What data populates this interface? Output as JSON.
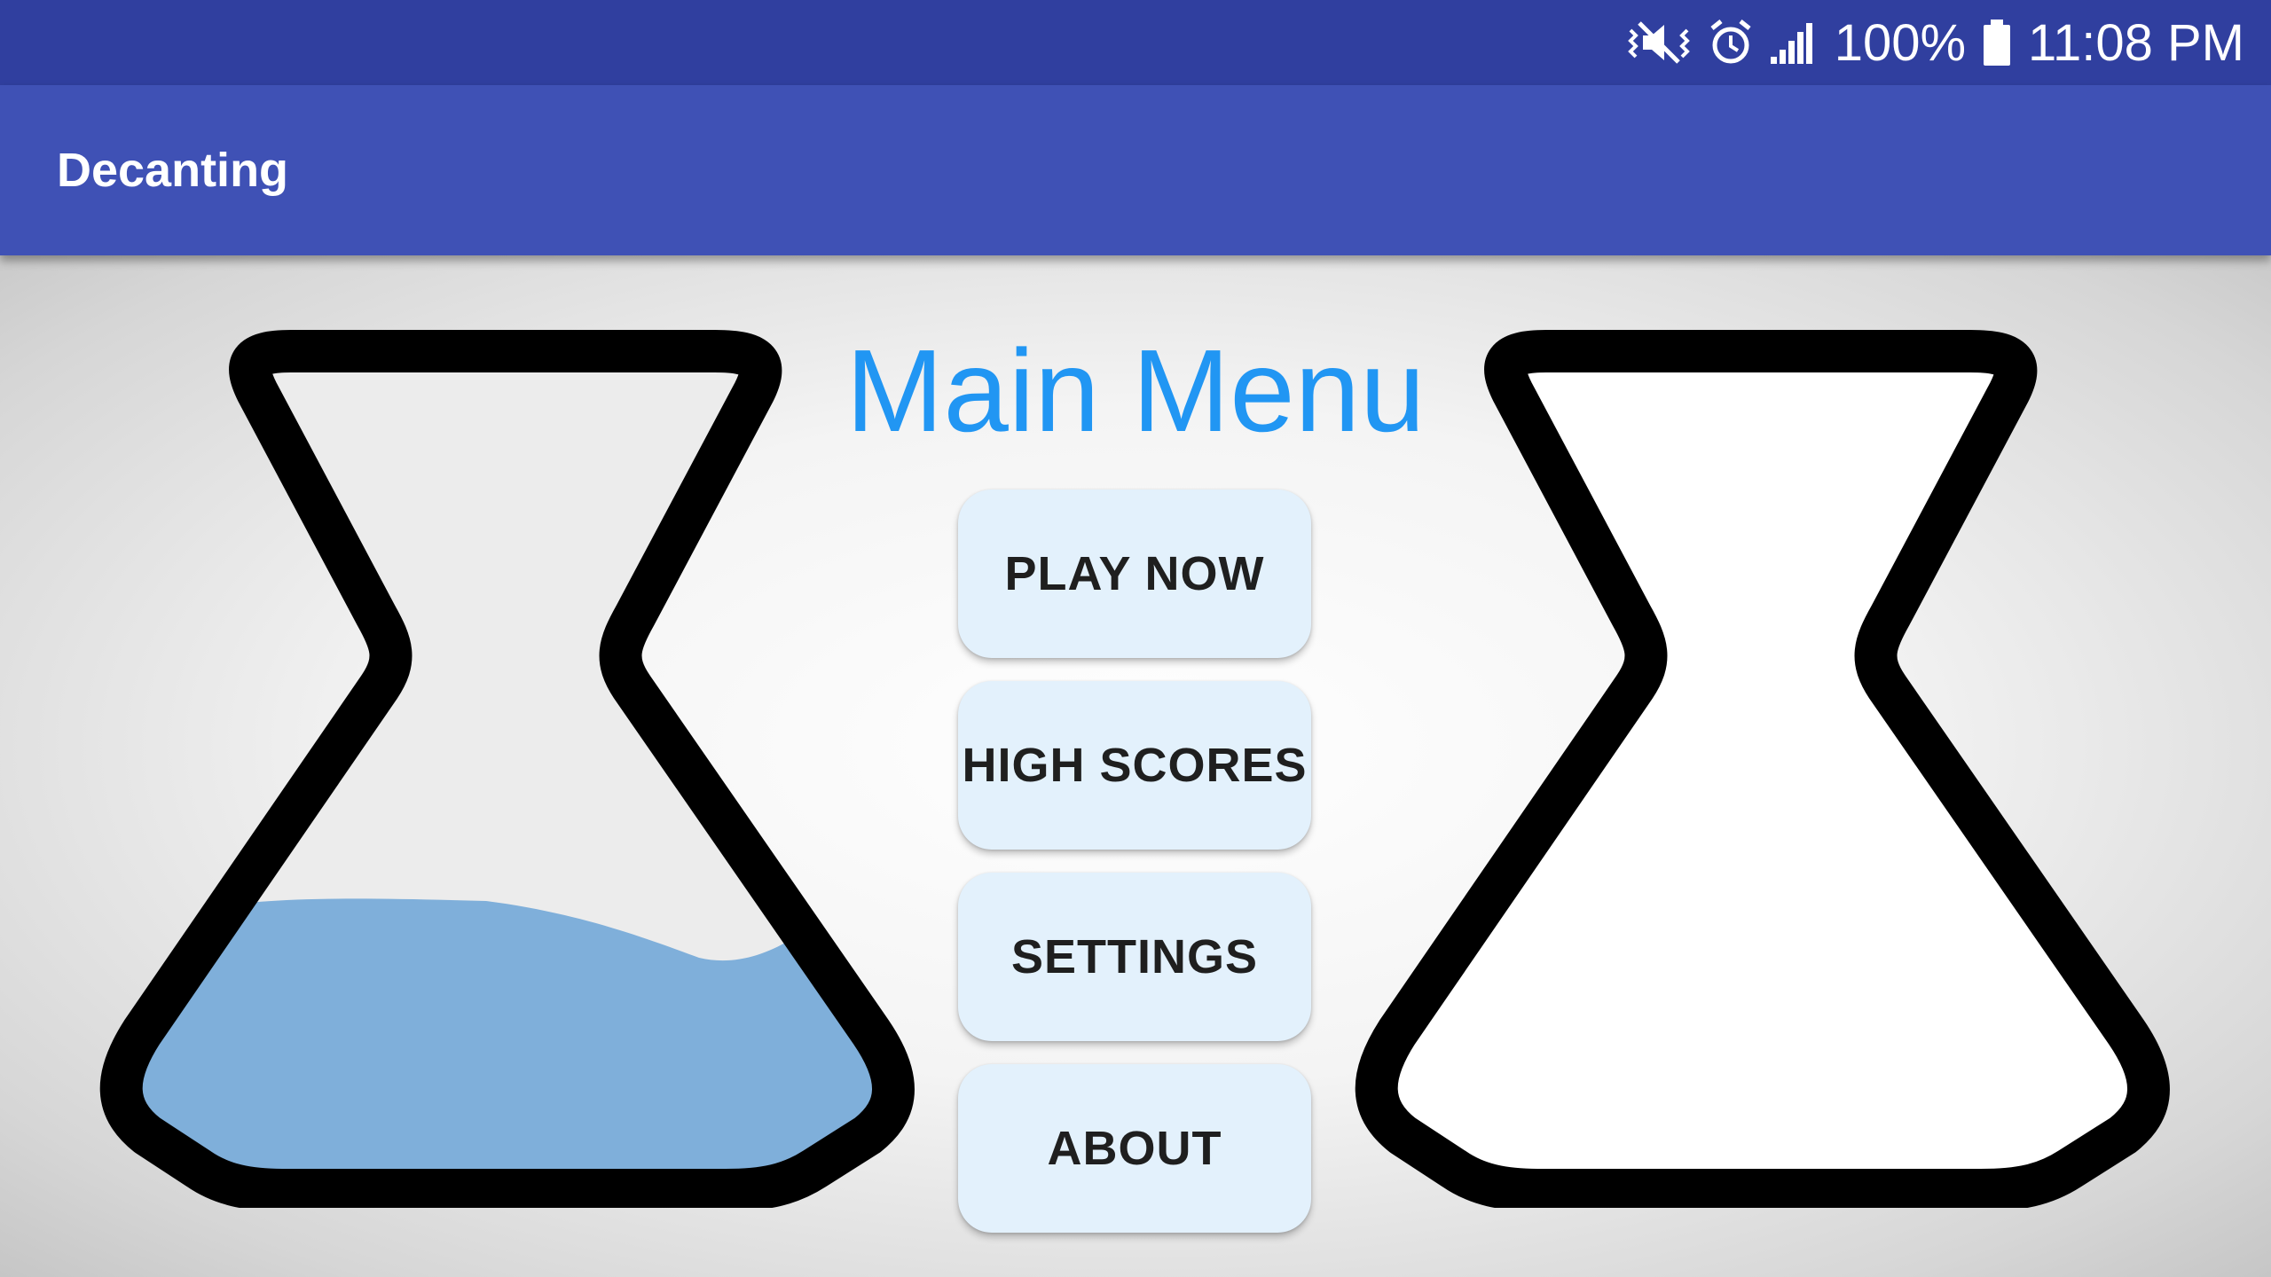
{
  "status_bar": {
    "battery_text": "100%",
    "time": "11:08 PM",
    "icons": [
      "vibrate-icon",
      "alarm-icon",
      "signal-icon",
      "battery-icon"
    ]
  },
  "app_bar": {
    "title": "Decanting"
  },
  "main": {
    "title": "Main Menu",
    "buttons": {
      "play": "PLAY NOW",
      "scores": "HIGH SCORES",
      "settings": "SETTINGS",
      "about": "ABOUT"
    }
  },
  "flasks": {
    "left_state": "partially filled",
    "right_state": "empty"
  },
  "colors": {
    "status_bar": "#303f9f",
    "app_bar": "#3f51b5",
    "title": "#2196f3",
    "button_bg": "#e3f1fc",
    "liquid": "#7fafda"
  }
}
